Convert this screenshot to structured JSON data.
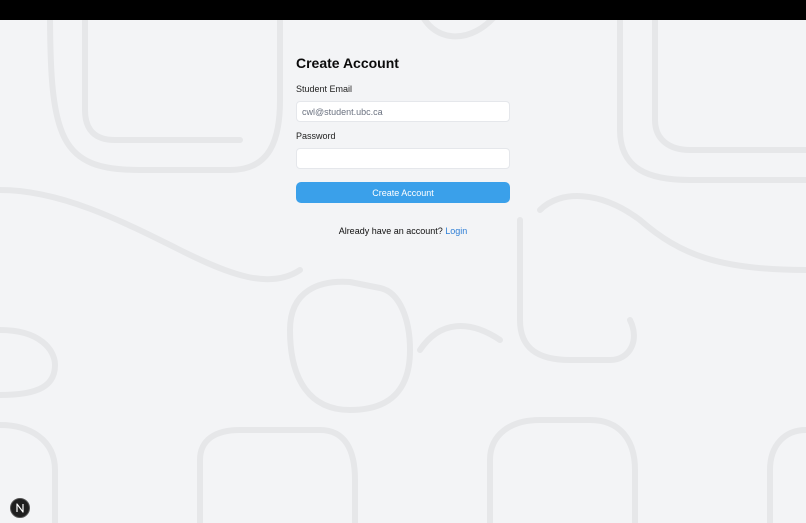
{
  "page": {
    "title": "Create Account"
  },
  "form": {
    "email_label": "Student Email",
    "email_placeholder": "cwl@student.ubc.ca",
    "email_value": "",
    "password_label": "Password",
    "password_placeholder": "",
    "password_value": "",
    "submit_label": "Create Account"
  },
  "footer": {
    "prompt": "Already have an account?",
    "login_label": "Login"
  },
  "dev_badge": {
    "icon": "nextjs-n-icon",
    "letter": "N"
  },
  "colors": {
    "background": "#f3f4f6",
    "primary_button": "#3aa0ea",
    "link": "#2f7fd6",
    "topbar": "#000000"
  }
}
